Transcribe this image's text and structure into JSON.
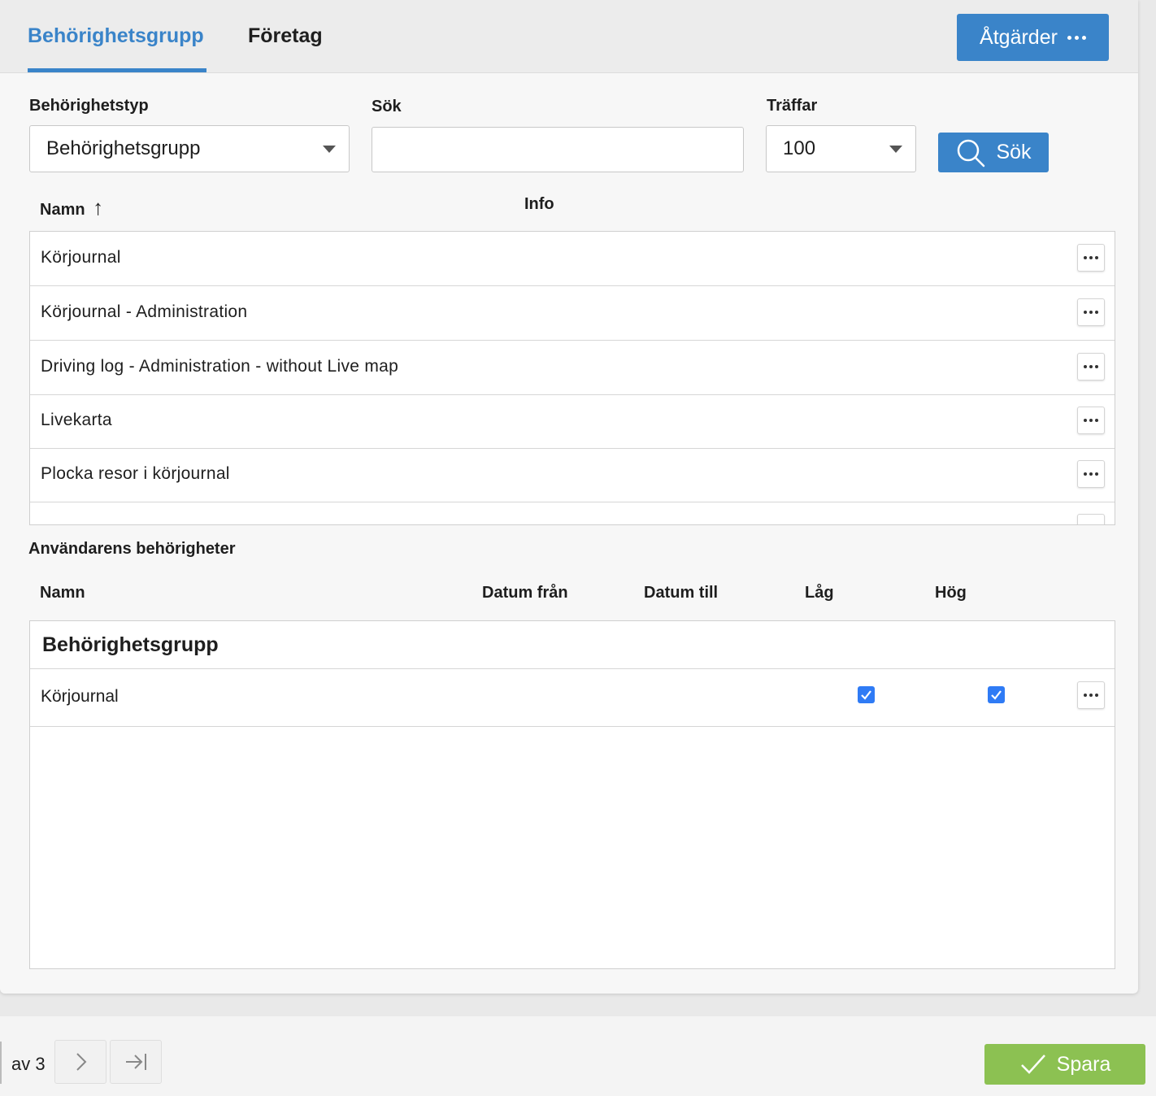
{
  "tabs": [
    {
      "label": "Behörighetsgrupp",
      "active": true
    },
    {
      "label": "Företag",
      "active": false
    }
  ],
  "actions_button": {
    "label": "Åtgärder"
  },
  "filters": {
    "type_label": "Behörighetstyp",
    "type_value": "Behörighetsgrupp",
    "search_label": "Sök",
    "search_value": "",
    "hits_label": "Träffar",
    "hits_value": "100",
    "search_button_label": "Sök"
  },
  "results_table": {
    "columns": [
      "Namn",
      "Info"
    ],
    "sort_indicator": "↑",
    "rows": [
      "Körjournal",
      "Körjournal - Administration",
      "Driving log - Administration - without Live map",
      "Livekarta",
      "Plocka resor i körjournal"
    ]
  },
  "user_permissions": {
    "title": "Användarens behörigheter",
    "columns": [
      "Namn",
      "Datum från",
      "Datum till",
      "Låg",
      "Hög"
    ],
    "group_name": "Behörighetsgrupp",
    "rows": [
      {
        "name": "Körjournal",
        "datum_fran": "",
        "datum_till": "",
        "lag": true,
        "hog": true
      }
    ]
  },
  "footer": {
    "pager_text": "av 3",
    "save_label": "Spara"
  },
  "colors": {
    "accent": "#3a84c9",
    "save": "#8cc152",
    "checkbox": "#2f7bf5"
  }
}
